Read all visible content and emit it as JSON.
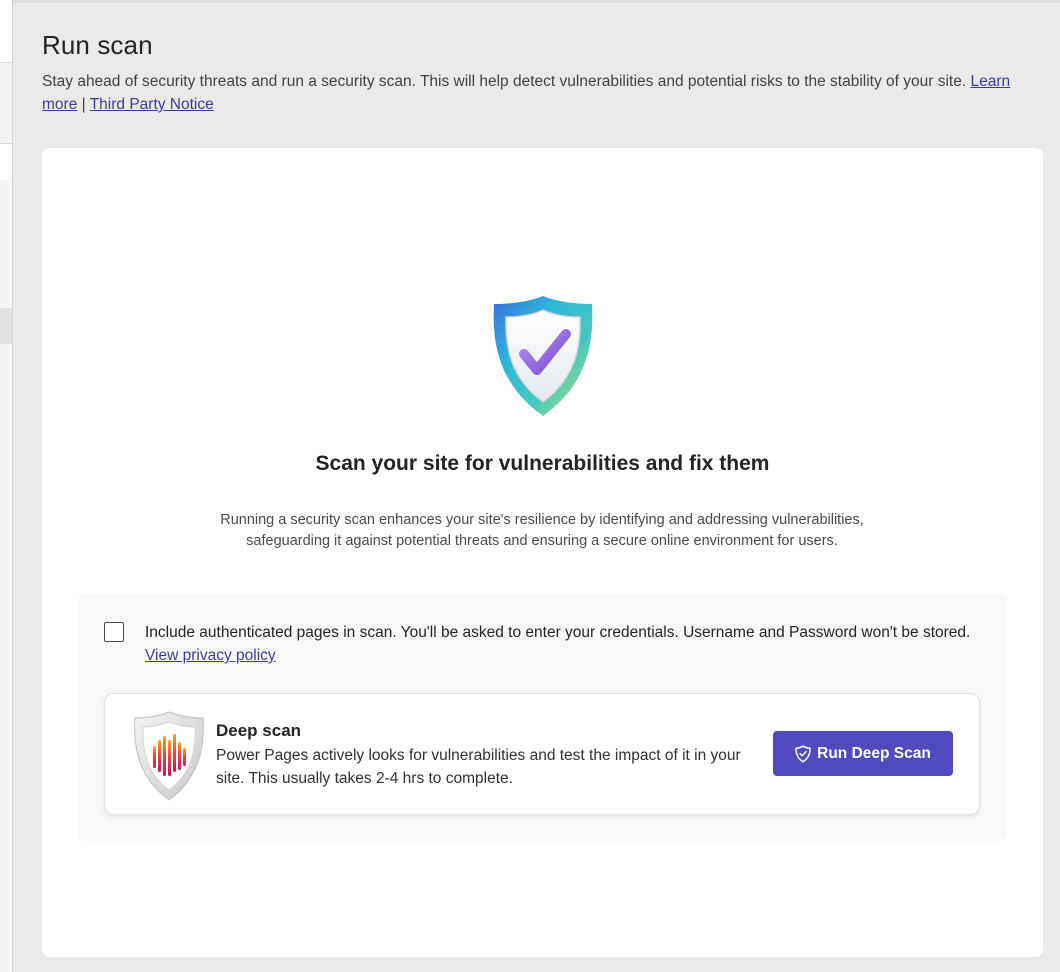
{
  "header": {
    "title": "Run scan",
    "description": "Stay ahead of security threats and run a security scan. This will help detect vulnerabilities and potential risks to the stability of your site.",
    "learn_more": "Learn more",
    "separator": "|",
    "third_party_notice": "Third Party Notice"
  },
  "card": {
    "icon": "shield-check-icon",
    "heading": "Scan your site for vulnerabilities and fix them",
    "subtext": "Running a security scan enhances your site's resilience by identifying and addressing vulnerabilities, safeguarding it against potential threats and ensuring a secure online environment for users."
  },
  "auth_option": {
    "checked": false,
    "label": "Include authenticated pages in scan. You'll be asked to enter your credentials. Username and Password won't be stored.",
    "privacy_link": "View privacy policy"
  },
  "deep_scan": {
    "icon": "deep-scan-shield-icon",
    "title": "Deep scan",
    "description": "Power Pages actively looks for vulnerabilities and test the impact of it in your site. This usually takes 2-4 hrs to complete.",
    "button_label": "Run Deep Scan",
    "button_icon": "shield-icon"
  },
  "colors": {
    "accent": "#4f4bbf",
    "link": "#3b3aa6",
    "background": "#ebeae8"
  }
}
